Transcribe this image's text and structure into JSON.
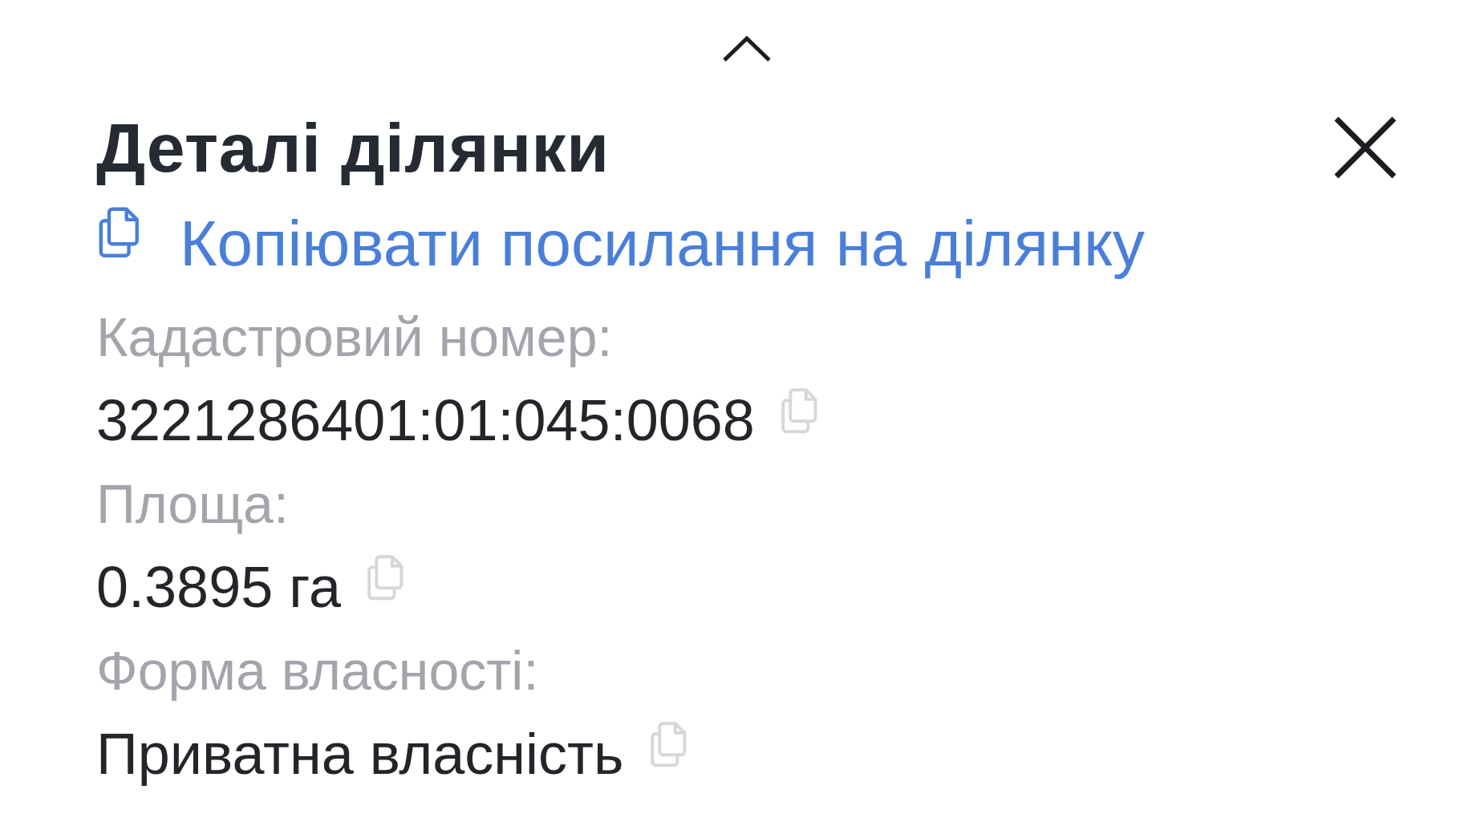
{
  "title": "Деталі ділянки",
  "copy_link": "Копіювати посилання на ділянку",
  "fields": [
    {
      "label": "Кадастровий номер:",
      "value": "3221286401:01:045:0068"
    },
    {
      "label": "Площа:",
      "value": "0.3895 га"
    },
    {
      "label": "Форма власності:",
      "value": "Приватна власність"
    }
  ]
}
